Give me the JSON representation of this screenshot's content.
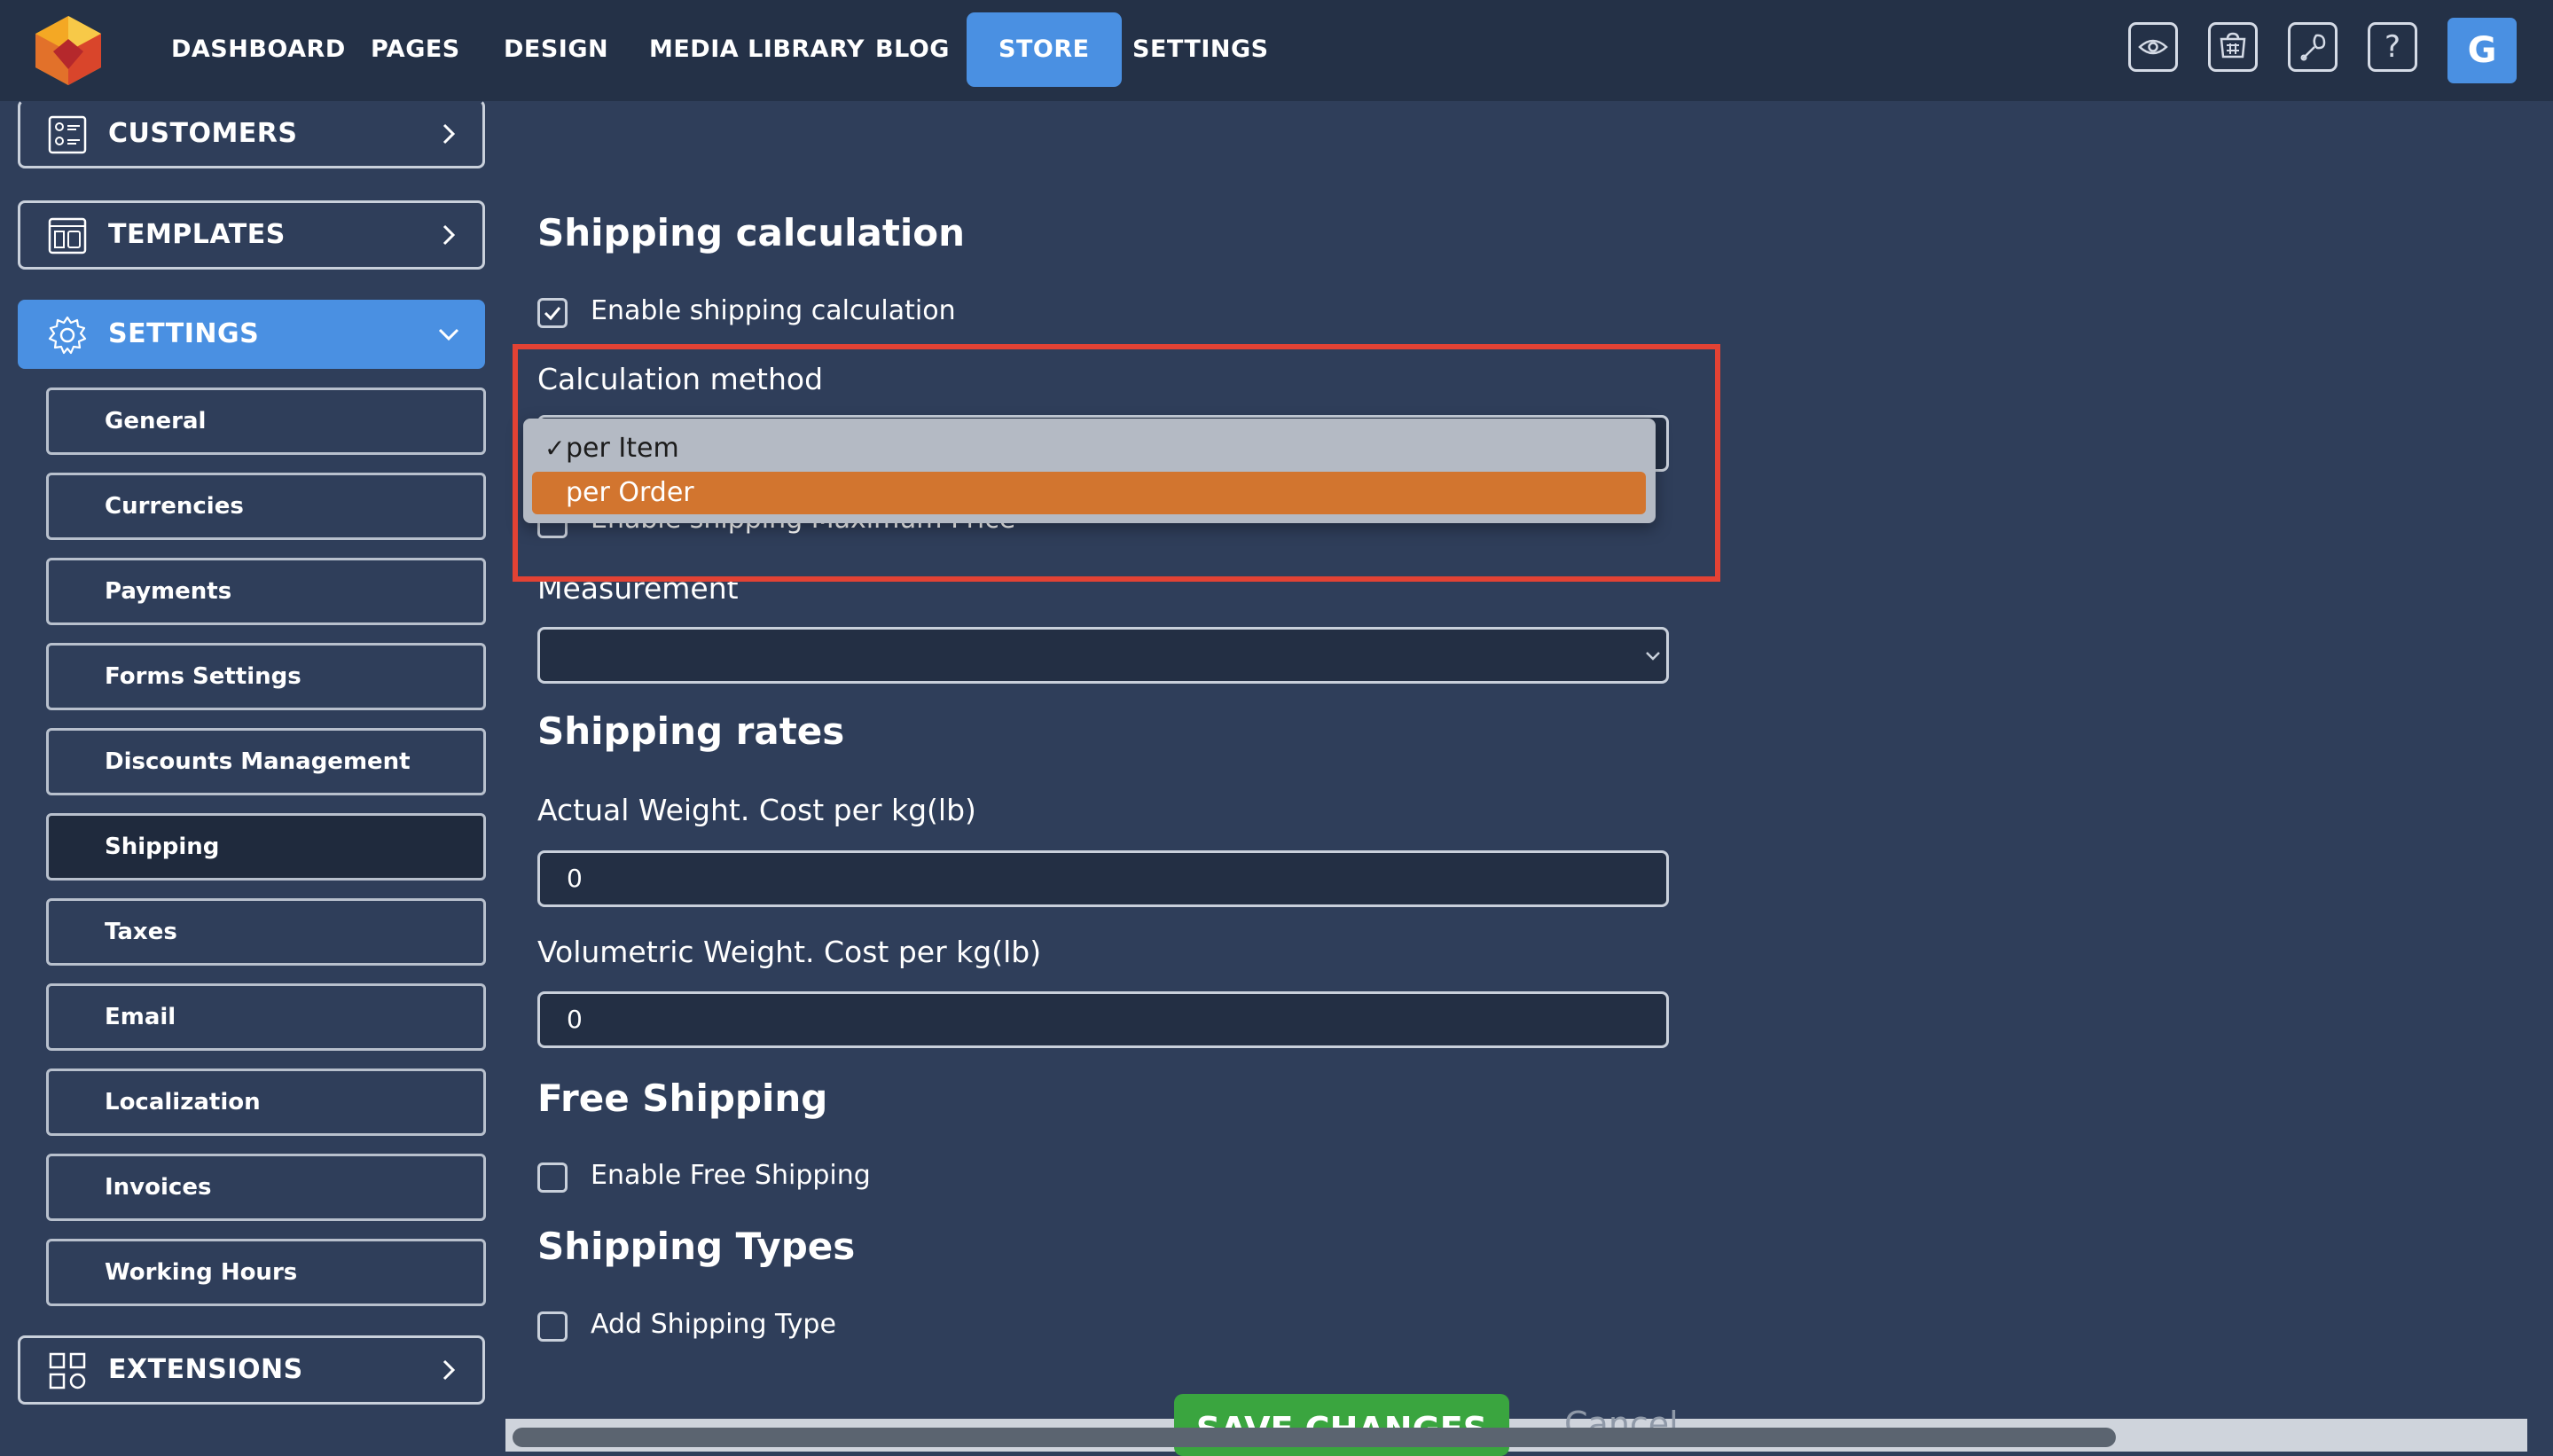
{
  "nav": {
    "items": [
      "DASHBOARD",
      "PAGES",
      "DESIGN",
      "MEDIA LIBRARY",
      "BLOG",
      "STORE",
      "SETTINGS"
    ],
    "active": "STORE"
  },
  "toolbar": {
    "icons": [
      "eye-icon",
      "cart-icon",
      "wrench-icon",
      "help-icon"
    ],
    "help_glyph": "?",
    "avatar_letter": "G"
  },
  "sidebar": {
    "customers": "CUSTOMERS",
    "templates": "TEMPLATES",
    "settings": "SETTINGS",
    "extensions": "EXTENSIONS",
    "settings_items": [
      "General",
      "Currencies",
      "Payments",
      "Forms Settings",
      "Discounts Management",
      "Shipping",
      "Taxes",
      "Email",
      "Localization",
      "Invoices",
      "Working Hours"
    ],
    "current_item": "Shipping"
  },
  "content": {
    "shipping_calculation_heading": "Shipping calculation",
    "enable_calc_label": "Enable shipping calculation",
    "enable_calc_checked": true,
    "calc_method_label": "Calculation method",
    "calc_method_options": [
      "per Item",
      "per Order"
    ],
    "calc_method_selected": "per Item",
    "calc_method_highlighted": "per Order",
    "check_mark": "✓",
    "max_price_label": "Enable shipping Maximum Price",
    "measurement_label": "Measurement",
    "measurement_value": "",
    "shipping_rates_heading": "Shipping rates",
    "actual_weight_label": "Actual Weight. Cost per kg(lb)",
    "actual_weight_value": "0",
    "volumetric_weight_label": "Volumetric Weight. Cost per kg(lb)",
    "volumetric_weight_value": "0",
    "free_shipping_heading": "Free Shipping",
    "enable_free_label": "Enable Free Shipping",
    "shipping_types_heading": "Shipping Types",
    "add_type_label": "Add Shipping Type",
    "save_label": "SAVE CHANGES",
    "cancel_label": "Cancel"
  },
  "colors": {
    "accent": "#4a90e2",
    "background": "#2f3e5a",
    "topbar": "#243147",
    "dropdown_highlight": "#d2752f",
    "save_button": "#3aa53f",
    "annotation": "#e34234"
  }
}
